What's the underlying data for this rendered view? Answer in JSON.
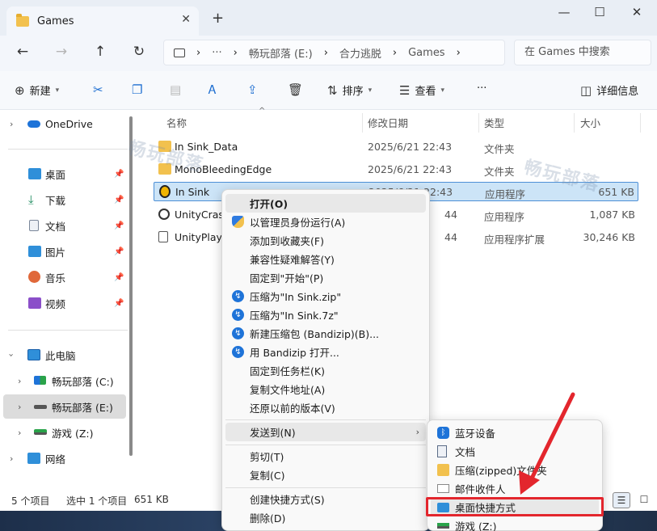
{
  "titlebar": {
    "tab_title": "Games",
    "tab_close": "✕",
    "new_tab": "+",
    "minimize": "—",
    "maximize": "☐",
    "close": "✕"
  },
  "nav": {
    "back": "←",
    "forward": "→",
    "up": "↑",
    "refresh": "↻",
    "breadcrumb_more": "···",
    "breadcrumb": [
      "畅玩部落 (E:)",
      "合力逃脱",
      "Games"
    ],
    "search_placeholder": "在 Games 中搜索"
  },
  "toolbar": {
    "new": "新建",
    "sort": "排序",
    "view": "查看",
    "more": "···",
    "details": "详细信息"
  },
  "sidebar": {
    "onedrive": "OneDrive",
    "quick": [
      {
        "label": "桌面",
        "color": "#2f8fd9"
      },
      {
        "label": "下载",
        "color": "#1f8c5f"
      },
      {
        "label": "文档",
        "color": "#7a8699"
      },
      {
        "label": "图片",
        "color": "#2f8fd9"
      },
      {
        "label": "音乐",
        "color": "#e0683a"
      },
      {
        "label": "视频",
        "color": "#8b4fc9"
      }
    ],
    "this_pc": "此电脑",
    "drives": [
      "畅玩部落 (C:)",
      "畅玩部落 (E:)",
      "游戏 (Z:)"
    ],
    "network": "网络"
  },
  "columns": {
    "name": "名称",
    "date": "修改日期",
    "type": "类型",
    "size": "大小"
  },
  "files": [
    {
      "name": "In Sink_Data",
      "date": "2025/6/21 22:43",
      "type": "文件夹",
      "size": "",
      "icon": "folder"
    },
    {
      "name": "MonoBleedingEdge",
      "date": "2025/6/21 22:43",
      "type": "文件夹",
      "size": "",
      "icon": "folder"
    },
    {
      "name": "In Sink",
      "date": "2025/6/21 22:43",
      "type": "应用程序",
      "size": "651 KB",
      "icon": "app"
    },
    {
      "name": "UnityCrash",
      "date": "44",
      "type": "应用程序",
      "size": "1,087 KB",
      "icon": "gear"
    },
    {
      "name": "UnityPlaye",
      "date": "44",
      "type": "应用程序扩展",
      "size": "30,246 KB",
      "icon": "doc"
    }
  ],
  "watermark": "畅玩部落",
  "status": {
    "count": "5 个项目",
    "selected": "选中 1 个项目",
    "size": "651 KB"
  },
  "context_menu": {
    "open": "打开(O)",
    "run_admin": "以管理员身份运行(A)",
    "add_favorites": "添加到收藏夹(F)",
    "compat": "兼容性疑难解答(Y)",
    "pin_start": "固定到\"开始\"(P)",
    "zip": "压缩为\"In Sink.zip\"",
    "sevenz": "压缩为\"In Sink.7z\"",
    "new_archive": "新建压缩包 (Bandizip)(B)...",
    "bandizip_open": "用 Bandizip 打开...",
    "pin_taskbar": "固定到任务栏(K)",
    "copy_path": "复制文件地址(A)",
    "restore": "还原以前的版本(V)",
    "send_to": "发送到(N)",
    "cut": "剪切(T)",
    "copy": "复制(C)",
    "create_shortcut": "创建快捷方式(S)",
    "delete": "删除(D)"
  },
  "send_to_menu": [
    "蓝牙设备",
    "文档",
    "压缩(zipped)文件夹",
    "邮件收件人",
    "桌面快捷方式",
    "游戏 (Z:)"
  ],
  "colors": {
    "accent": "#1f6fd1",
    "selection": "#cce4f7",
    "annotation": "#e3262d"
  }
}
